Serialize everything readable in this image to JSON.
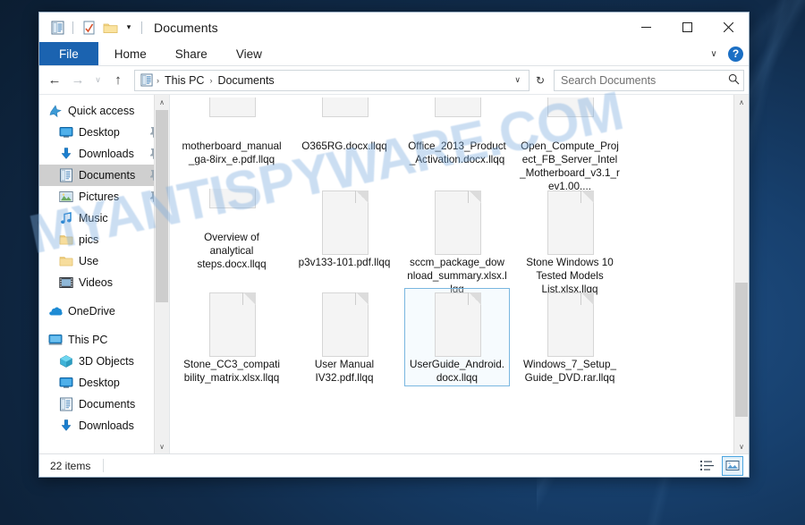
{
  "window": {
    "title": "Documents",
    "quick_access": [
      {
        "name": "documents-icon",
        "glyph": "doc"
      },
      {
        "name": "properties-icon",
        "glyph": "check"
      },
      {
        "name": "new-folder-icon",
        "glyph": "folder"
      }
    ],
    "controls": {
      "minimize": "─",
      "maximize": "□",
      "close": "✕"
    }
  },
  "ribbon": {
    "tabs": [
      {
        "label": "File",
        "active": true
      },
      {
        "label": "Home",
        "active": false
      },
      {
        "label": "Share",
        "active": false
      },
      {
        "label": "View",
        "active": false
      }
    ],
    "collapse_chevron": "∨",
    "help_label": "?"
  },
  "address": {
    "back": "←",
    "forward": "→",
    "recent_chevron": "∨",
    "up": "↑",
    "breadcrumbs": [
      "This PC",
      "Documents"
    ],
    "separator": "›",
    "dropdown": "∨",
    "refresh": "↻"
  },
  "search": {
    "placeholder": "Search Documents",
    "icon": "⌕"
  },
  "sidebar": {
    "items": [
      {
        "label": "Quick access",
        "icon": "pin-star-icon",
        "level": 0,
        "selected": false,
        "pinned": false
      },
      {
        "label": "Desktop",
        "icon": "desktop-icon",
        "level": 1,
        "selected": false,
        "pinned": true
      },
      {
        "label": "Downloads",
        "icon": "download-icon",
        "level": 1,
        "selected": false,
        "pinned": true
      },
      {
        "label": "Documents",
        "icon": "documents-icon",
        "level": 1,
        "selected": true,
        "pinned": true
      },
      {
        "label": "Pictures",
        "icon": "pictures-icon",
        "level": 1,
        "selected": false,
        "pinned": true
      },
      {
        "label": "Music",
        "icon": "music-icon",
        "level": 1,
        "selected": false,
        "pinned": false
      },
      {
        "label": "pics",
        "icon": "folder-icon",
        "level": 1,
        "selected": false,
        "pinned": false
      },
      {
        "label": "Use",
        "icon": "folder-icon",
        "level": 1,
        "selected": false,
        "pinned": false
      },
      {
        "label": "Videos",
        "icon": "videos-icon",
        "level": 1,
        "selected": false,
        "pinned": false
      },
      {
        "label": "OneDrive",
        "icon": "onedrive-icon",
        "level": 0,
        "selected": false,
        "pinned": false,
        "gap_before": true
      },
      {
        "label": "This PC",
        "icon": "thispc-icon",
        "level": 0,
        "selected": false,
        "pinned": false,
        "gap_before": true
      },
      {
        "label": "3D Objects",
        "icon": "3dobjects-icon",
        "level": 1,
        "selected": false,
        "pinned": false
      },
      {
        "label": "Desktop",
        "icon": "desktop-icon",
        "level": 1,
        "selected": false,
        "pinned": false
      },
      {
        "label": "Documents",
        "icon": "documents-icon",
        "level": 1,
        "selected": false,
        "pinned": false
      },
      {
        "label": "Downloads",
        "icon": "download-icon",
        "level": 1,
        "selected": false,
        "pinned": false
      }
    ],
    "scroll_up": "∧",
    "scroll_down": "∨"
  },
  "files": [
    {
      "name": "motherboard_manual_ga-8irx_e.pdf.llqq",
      "icon": "file-icon",
      "selected": false,
      "clipped": true
    },
    {
      "name": "O365RG.docx.llqq",
      "icon": "file-icon",
      "selected": false,
      "clipped": true
    },
    {
      "name": "Office_2013_Product_Activation.docx.llqq",
      "icon": "file-icon",
      "selected": false,
      "clipped": true
    },
    {
      "name": "Open_Compute_Project_FB_Server_Intel_Motherboard_v3.1_rev1.00....",
      "icon": "file-icon",
      "selected": false,
      "clipped": true
    },
    {
      "name": "Overview of analytical steps.docx.llqq",
      "icon": "file-icon",
      "selected": false,
      "clipped": true
    },
    {
      "name": "p3v133-101.pdf.llqq",
      "icon": "file-icon",
      "selected": false,
      "clipped": false
    },
    {
      "name": "sccm_package_download_summary.xlsx.llqq",
      "icon": "file-icon",
      "selected": false,
      "clipped": false
    },
    {
      "name": "Stone Windows 10 Tested Models List.xlsx.llqq",
      "icon": "file-icon",
      "selected": false,
      "clipped": false
    },
    {
      "name": "Stone_CC3_compatibility_matrix.xlsx.llqq",
      "icon": "file-icon",
      "selected": false,
      "clipped": false
    },
    {
      "name": "User Manual IV32.pdf.llqq",
      "icon": "file-icon",
      "selected": false,
      "clipped": false
    },
    {
      "name": "UserGuide_Android.docx.llqq",
      "icon": "file-icon",
      "selected": true,
      "clipped": false
    },
    {
      "name": "Windows_7_Setup_Guide_DVD.rar.llqq",
      "icon": "file-icon",
      "selected": false,
      "clipped": false
    }
  ],
  "content_scroll": {
    "scroll_up": "∧",
    "scroll_down": "∨"
  },
  "status": {
    "item_count": "22 items",
    "views": [
      {
        "name": "details-view-button",
        "active": false
      },
      {
        "name": "large-icons-view-button",
        "active": true
      }
    ]
  },
  "watermark": {
    "text": "MYANTISPYWARE.COM",
    "color": "#7cacde"
  },
  "colors": {
    "accent": "#1b63b0",
    "selection": "#7ab7e0",
    "desktop": "#0d2033"
  }
}
